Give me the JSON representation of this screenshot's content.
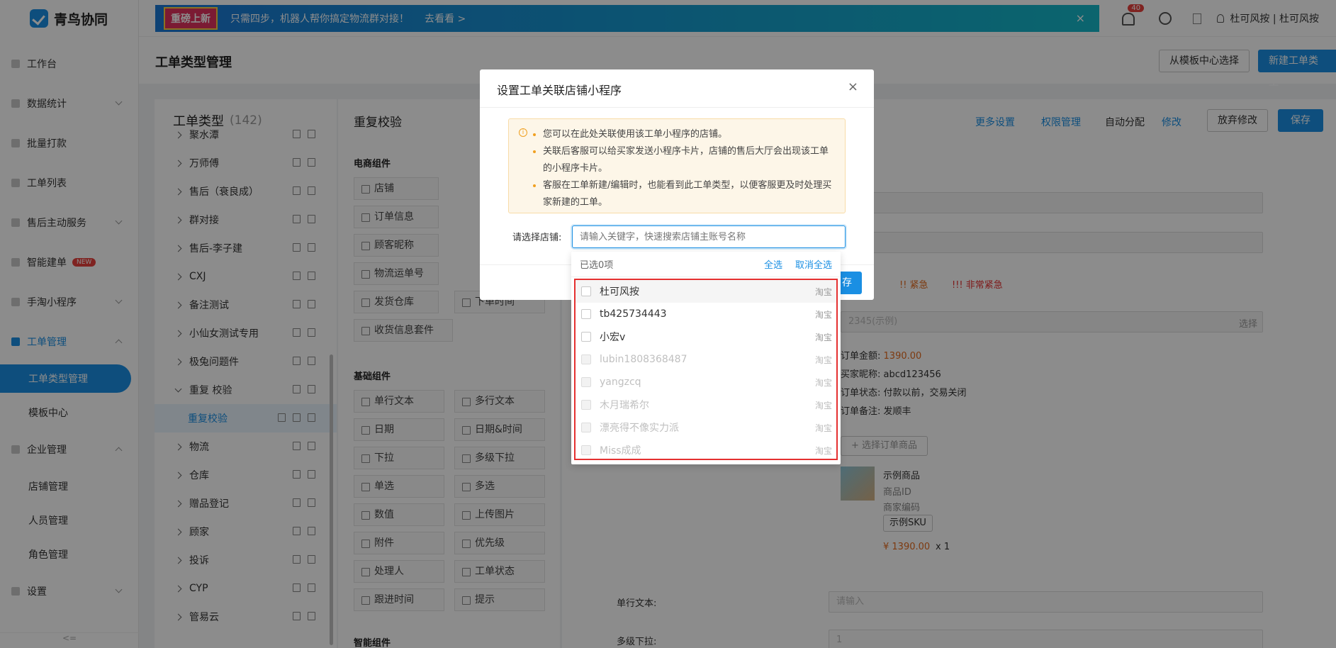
{
  "app": {
    "name": "青鸟协同"
  },
  "sidebar": {
    "items": [
      {
        "label": "工作台"
      },
      {
        "label": "数据统计"
      },
      {
        "label": "批量打款"
      },
      {
        "label": "工单列表"
      },
      {
        "label": "售后主动服务"
      },
      {
        "label": "智能建单",
        "badge": "NEW"
      },
      {
        "label": "手淘小程序"
      },
      {
        "label": "工单管理"
      },
      {
        "label": "工单类型管理"
      },
      {
        "label": "模板中心"
      },
      {
        "label": "企业管理"
      },
      {
        "label": "店铺管理"
      },
      {
        "label": "人员管理"
      },
      {
        "label": "角色管理"
      },
      {
        "label": "设置"
      }
    ],
    "collapse": "<="
  },
  "banner": {
    "tag": "重磅上新",
    "text": "只需四步，机器人帮你搞定物流群对接！",
    "link": "去看看 >",
    "close": "×"
  },
  "header": {
    "notif_count": "40",
    "user": "杜可风按 | 杜可风按"
  },
  "page": {
    "title": "工单类型管理",
    "btn_template": "从模板中心选择",
    "btn_new": "新建工单类型"
  },
  "types": {
    "title": "工单类型",
    "count": "(142)",
    "items": [
      "聚水潭",
      "万师傅",
      "售后（衰良成）",
      "群对接",
      "售后-李子建",
      "CXJ",
      "备注测试",
      "小仙女测试专用",
      "极兔问题件",
      "重复 校验",
      "重复校验",
      "物流",
      "仓库",
      "赠品登记",
      "顾家",
      "投诉",
      "CYP",
      "管易云"
    ]
  },
  "components": {
    "title": "重复校验",
    "ecommerce_title": "电商组件",
    "ecommerce": [
      "店铺",
      "订单信息",
      "顾客昵称",
      "物流运单号",
      "发货仓库",
      "收货信息套件",
      "下单时间"
    ],
    "basic_title": "基础组件",
    "basic": [
      "单行文本",
      "多行文本",
      "日期",
      "日期&时间",
      "下拉",
      "多级下拉",
      "单选",
      "多选",
      "数值",
      "上传图片",
      "附件",
      "优先级",
      "处理人",
      "工单状态",
      "跟进时间",
      "提示"
    ],
    "smart_title": "智能组件"
  },
  "form": {
    "more_settings": "更多设置",
    "permission": "权限管理",
    "auto_assign": "自动分配",
    "modify": "修改",
    "discard": "放弃修改",
    "save": "保存",
    "priority_urgent": "!! 紧急",
    "priority_very_urgent": "!!! 非常紧急",
    "order_placeholder": "2345(示例)",
    "select": "选择",
    "order_amount_label": "订单金额:",
    "order_amount": "1390.00",
    "buyer_label": "买家昵称:",
    "buyer": "abcd123456",
    "status_label": "订单状态:",
    "status": "付款以前，交易关闭",
    "remark_label": "订单备注:",
    "remark": "发顺丰",
    "pick_goods": "+ 选择订单商品",
    "product_name": "示例商品",
    "product_id": "商品ID",
    "product_code": "商家编码",
    "sku": "示例SKU",
    "price": "¥ 1390.00",
    "qty": "x 1",
    "single_text_label": "单行文本:",
    "single_text_placeholder": "请输入",
    "multi_dropdown_label": "多级下拉:",
    "multi_dropdown_value": "1"
  },
  "modal": {
    "title": "设置工单关联店铺小程序",
    "close": "×",
    "notices": [
      "您可以在此处关联使用该工单小程序的店铺。",
      "关联后客服可以给买家发送小程序卡片，店铺的售后大厅会出现该工单的小程序卡片。",
      "客服在工单新建/编辑时，也能看到此工单类型，以便客服更及时处理买家新建的工单。"
    ],
    "store_label": "请选择店铺:",
    "store_placeholder": "请输入关键字，快速搜索店铺主账号名称",
    "save_partial": "存"
  },
  "dropdown": {
    "selected": "已选0项",
    "select_all": "全选",
    "deselect_all": "取消全选",
    "items": [
      {
        "name": "杜可风按",
        "platform": "淘宝"
      },
      {
        "name": "tb425734443",
        "platform": "淘宝"
      },
      {
        "name": "小宏v",
        "platform": "淘宝"
      },
      {
        "name": "lubin1808368487",
        "platform": "淘宝"
      },
      {
        "name": "yangzcq",
        "platform": "淘宝"
      },
      {
        "name": "木月瑞希尔",
        "platform": "淘宝"
      },
      {
        "name": "漂亮得不像实力派",
        "platform": "淘宝"
      },
      {
        "name": "Miss成成",
        "platform": "淘宝"
      }
    ]
  }
}
